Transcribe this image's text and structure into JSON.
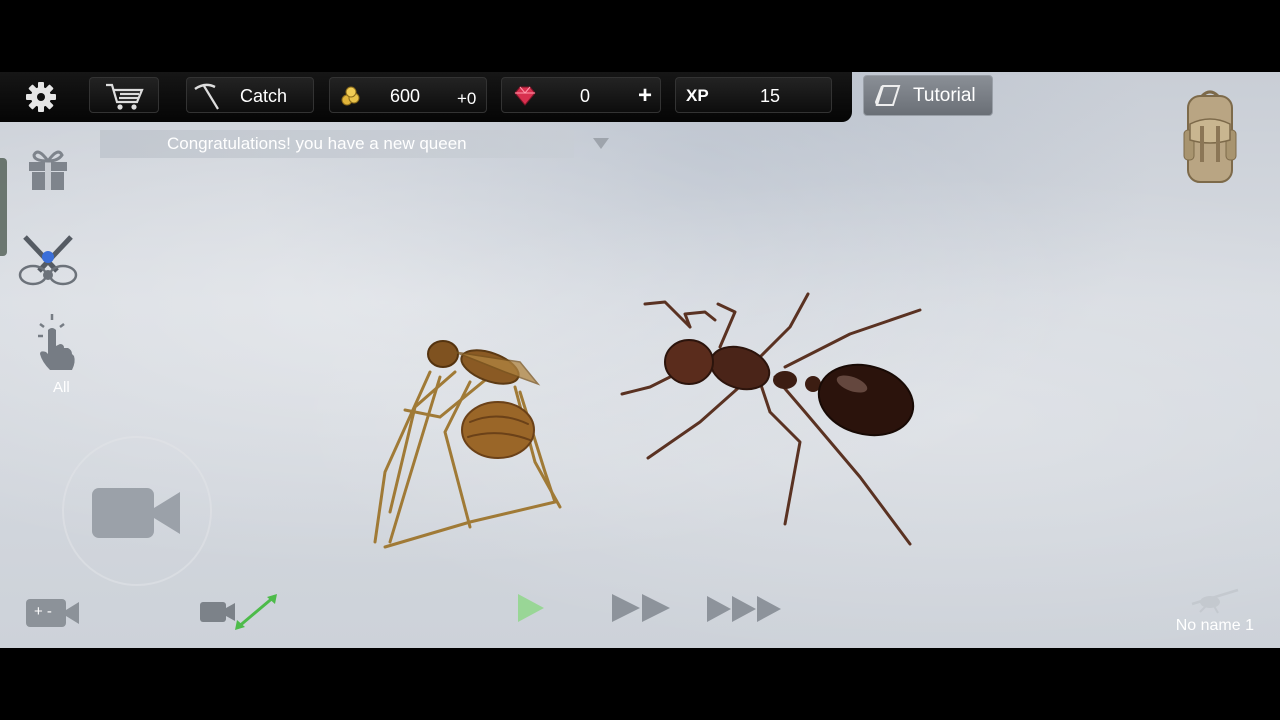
{
  "hud": {
    "catch_label": "Catch",
    "coins": "600",
    "coins_delta": "+0",
    "gems": "0",
    "gems_add": "+",
    "xp_label": "XP",
    "xp": "15",
    "tutorial_label": "Tutorial"
  },
  "notification": "Congratulations! you have a new queen",
  "side": {
    "select_all_label": "All"
  },
  "bottom": {
    "zoom_label": "+ -",
    "colony_name": "No name 1"
  },
  "colors": {
    "hud_bg": "#0a0a0a",
    "accent_green": "#3fd041",
    "gem": "#d8304f",
    "coin": "#e0b43a",
    "ground": "#d2d6dc"
  },
  "icons": [
    "gear-icon",
    "cart-icon",
    "pickaxe-icon",
    "coins-icon",
    "gem-icon",
    "plus-icon",
    "book-icon",
    "backpack-icon",
    "gift-icon",
    "crossed-swords-icon",
    "tap-hand-icon",
    "camera-icon",
    "play-icon",
    "fast-forward-icon",
    "fastest-forward-icon"
  ]
}
